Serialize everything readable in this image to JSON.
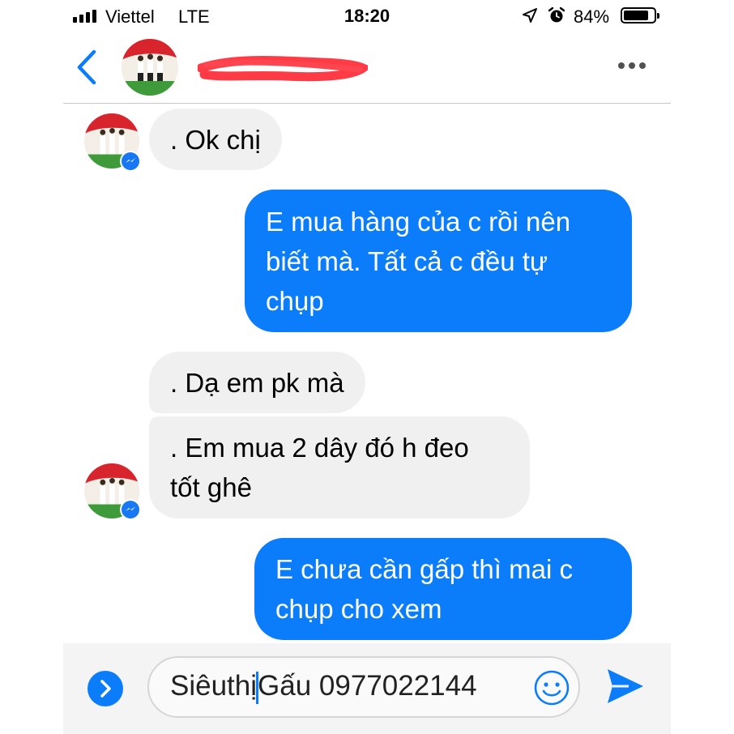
{
  "status_bar": {
    "carrier": "Viettel",
    "network": "LTE",
    "time": "18:20",
    "battery_percent": "84%",
    "battery_level": 0.84,
    "icons": [
      "signal-bars-icon",
      "location-arrow-icon",
      "alarm-clock-icon",
      "battery-icon"
    ]
  },
  "header": {
    "back_icon": "chevron-left-icon",
    "contact_avatar": "contact-avatar",
    "contact_name_redacted": true,
    "more_icon": "ellipsis-icon"
  },
  "messages": [
    {
      "direction": "incoming",
      "text": ". Ok chị"
    },
    {
      "direction": "outgoing",
      "lines": [
        "E mua hàng của c rồi nên",
        "biết mà. Tất cả c đều tự",
        "chụp"
      ]
    },
    {
      "direction": "incoming",
      "text": ". Dạ em pk mà"
    },
    {
      "direction": "incoming",
      "lines": [
        ". Em mua 2 dây đó h đeo",
        "tốt ghê"
      ]
    },
    {
      "direction": "outgoing",
      "lines": [
        "E chưa cần gấp thì mai c",
        "chụp cho xem"
      ]
    }
  ],
  "composer": {
    "text_before_caret": "Siêuthị",
    "text_after_caret": "Gấu 0977022144",
    "expand_icon": "chevron-right-icon",
    "emoji_icon": "smiley-icon",
    "send_icon": "send-arrow-icon"
  },
  "colors": {
    "outgoing_bubble": "#0b7dfa",
    "incoming_bubble": "#f1f0f0",
    "accent": "#0b7dfa",
    "redaction": "#ff3b46"
  }
}
